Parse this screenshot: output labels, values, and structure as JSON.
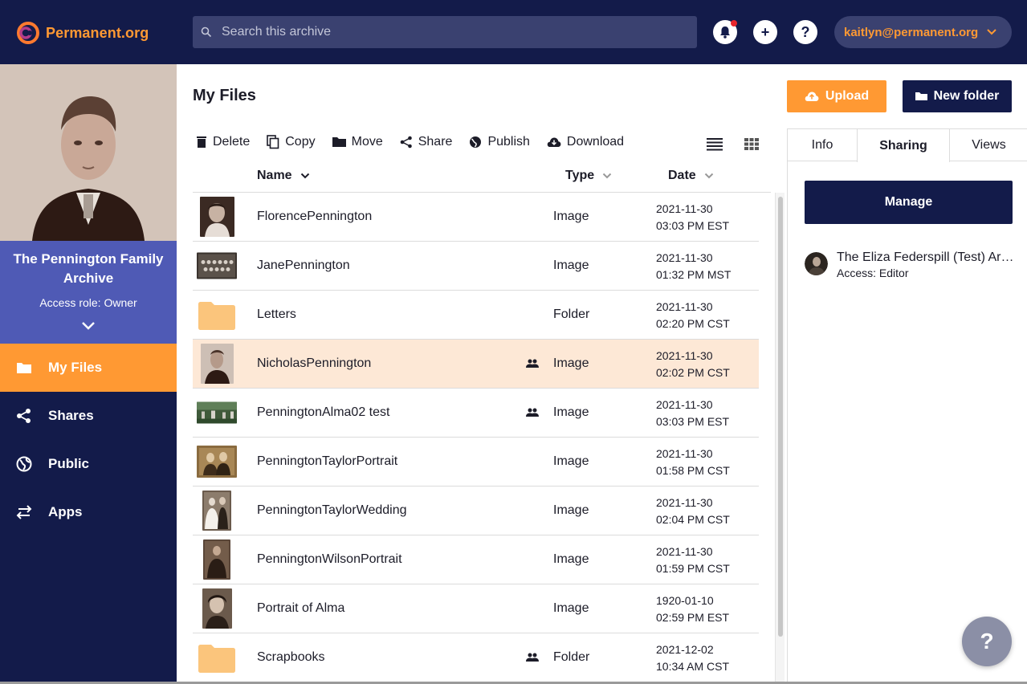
{
  "header": {
    "logo_text": "Permanent.org",
    "search_placeholder": "Search this archive",
    "account_label": "kaitlyn@permanent.org",
    "add_label": "+",
    "help_label": "?"
  },
  "sidebar": {
    "archive_name": "The Pennington Family Archive",
    "access_role": "Access role: Owner",
    "nav": [
      {
        "label": "My Files",
        "icon": "folder-icon",
        "active": true
      },
      {
        "label": "Shares",
        "icon": "share-icon",
        "active": false
      },
      {
        "label": "Public",
        "icon": "globe-icon",
        "active": false
      },
      {
        "label": "Apps",
        "icon": "swap-icon",
        "active": false
      }
    ]
  },
  "main": {
    "title": "My Files",
    "toolbar": {
      "delete": "Delete",
      "copy": "Copy",
      "move": "Move",
      "share": "Share",
      "publish": "Publish",
      "download": "Download"
    },
    "columns": {
      "name": "Name",
      "type": "Type",
      "date": "Date"
    },
    "rows": [
      {
        "name": "FlorencePennington",
        "type": "Image",
        "date": "2021-11-30",
        "time": "03:03 PM EST",
        "shared": false,
        "selected": false
      },
      {
        "name": "JanePennington",
        "type": "Image",
        "date": "2021-11-30",
        "time": "01:32 PM MST",
        "shared": false,
        "selected": false
      },
      {
        "name": "Letters",
        "type": "Folder",
        "date": "2021-11-30",
        "time": "02:20 PM CST",
        "shared": false,
        "selected": false
      },
      {
        "name": "NicholasPennington",
        "type": "Image",
        "date": "2021-11-30",
        "time": "02:02 PM CST",
        "shared": true,
        "selected": true
      },
      {
        "name": "PenningtonAlma02 test",
        "type": "Image",
        "date": "2021-11-30",
        "time": "03:03 PM EST",
        "shared": true,
        "selected": false
      },
      {
        "name": "PenningtonTaylorPortrait",
        "type": "Image",
        "date": "2021-11-30",
        "time": "01:58 PM CST",
        "shared": false,
        "selected": false
      },
      {
        "name": "PenningtonTaylorWedding",
        "type": "Image",
        "date": "2021-11-30",
        "time": "02:04 PM CST",
        "shared": false,
        "selected": false
      },
      {
        "name": "PenningtonWilsonPortrait",
        "type": "Image",
        "date": "2021-11-30",
        "time": "01:59 PM CST",
        "shared": false,
        "selected": false
      },
      {
        "name": "Portrait of Alma",
        "type": "Image",
        "date": "1920-01-10",
        "time": "02:59 PM EST",
        "shared": false,
        "selected": false
      },
      {
        "name": "Scrapbooks",
        "type": "Folder",
        "date": "2021-12-02",
        "time": "10:34 AM CST",
        "shared": true,
        "selected": false
      }
    ]
  },
  "actions": {
    "upload": "Upload",
    "new_folder": "New folder"
  },
  "panel": {
    "tabs": [
      "Info",
      "Sharing",
      "Views"
    ],
    "active_tab": "Sharing",
    "manage": "Manage",
    "share_name": "The Eliza Federspill (Test) Archive",
    "share_access": "Access: Editor"
  },
  "help_fab": "?",
  "colors": {
    "navy": "#131b4a",
    "orange": "#ff9933",
    "archive_card": "#4f5ab5",
    "selected_row": "#fde8d6"
  }
}
